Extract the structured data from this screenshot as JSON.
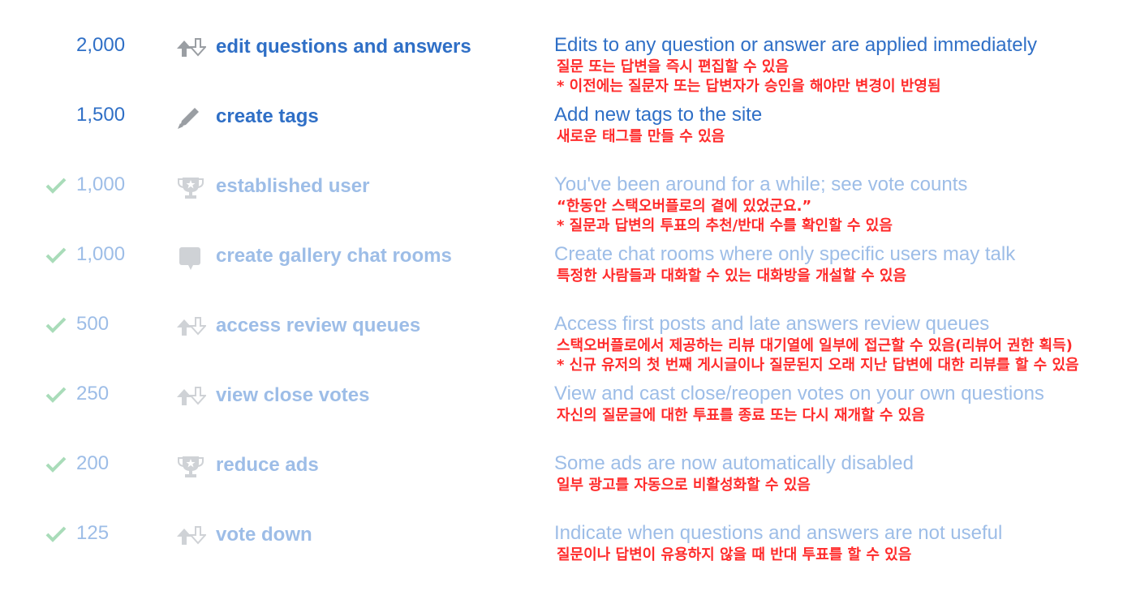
{
  "colors": {
    "active": "#2f6fc6",
    "faded": "#9dbde7",
    "korean": "#ff2b2b",
    "check": "#a9dcb9"
  },
  "privileges": [
    {
      "rep": "2,000",
      "icon": "vote-arrows-icon",
      "title": "edit questions and answers",
      "desc": "Edits to any question or answer are applied immediately",
      "ko": [
        "질문 또는 답변을 즉시 편집할 수 있음",
        "* 이전에는 질문자 또는 답변자가 승인을 해야만 변경이 반영됨"
      ],
      "earned": false
    },
    {
      "rep": "1,500",
      "icon": "pencil-icon",
      "title": "create tags",
      "desc": "Add new tags to the site",
      "ko": [
        "새로운 태그를 만들 수 있음"
      ],
      "earned": false
    },
    {
      "rep": "1,000",
      "icon": "trophy-icon",
      "title": "established user",
      "desc": "You've been around for a while; see vote counts",
      "ko": [
        "“한동안 스택오버플로의 곁에 있었군요.”",
        "* 질문과 답변의 투표의 추천/반대 수를 확인할 수 있음"
      ],
      "earned": true
    },
    {
      "rep": "1,000",
      "icon": "chat-bubble-icon",
      "title": "create gallery chat rooms",
      "desc": "Create chat rooms where only specific users may talk",
      "ko": [
        "특정한 사람들과 대화할 수 있는 대화방을 개설할 수 있음"
      ],
      "earned": true
    },
    {
      "rep": "500",
      "icon": "vote-arrows-icon",
      "title": "access review queues",
      "desc": "Access first posts and late answers review queues",
      "ko": [
        "스택오버플로에서 제공하는 리뷰 대기열에 일부에 접근할 수 있음(리뷰어 권한 획득)",
        "* 신규 유저의 첫 번째 게시글이나 질문된지 오래 지난 답변에 대한 리뷰를 할 수 있음"
      ],
      "earned": true
    },
    {
      "rep": "250",
      "icon": "vote-arrows-icon",
      "title": "view close votes",
      "desc": "View and cast close/reopen votes on your own questions",
      "ko": [
        "자신의 질문글에 대한 투표를 종료 또는 다시 재개할 수 있음"
      ],
      "earned": true
    },
    {
      "rep": "200",
      "icon": "trophy-icon",
      "title": "reduce ads",
      "desc": "Some ads are now automatically disabled",
      "ko": [
        "일부 광고를 자동으로 비활성화할 수 있음"
      ],
      "earned": true
    },
    {
      "rep": "125",
      "icon": "vote-arrows-icon",
      "title": "vote down",
      "desc": "Indicate when questions and answers are not useful",
      "ko": [
        "질문이나 답변이 유용하지 않을 때 반대 투표를 할 수 있음"
      ],
      "earned": true
    }
  ]
}
